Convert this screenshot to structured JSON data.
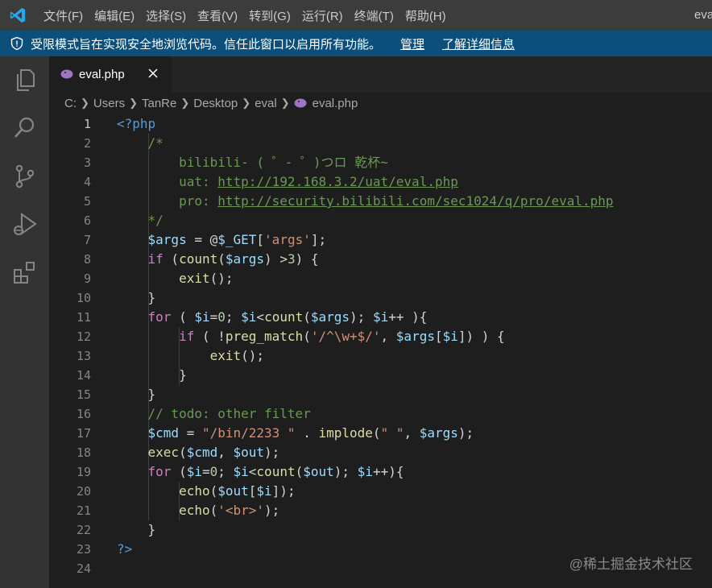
{
  "titlebar": {
    "menu": [
      "文件(F)",
      "编辑(E)",
      "选择(S)",
      "查看(V)",
      "转到(G)",
      "运行(R)",
      "终端(T)",
      "帮助(H)"
    ],
    "window_title": "eval.php"
  },
  "banner": {
    "message": "受限模式旨在实现安全地浏览代码。信任此窗口以启用所有功能。",
    "manage": "管理",
    "learn_more": "了解详细信息"
  },
  "activity_bar": [
    "explorer-icon",
    "search-icon",
    "source-control-icon",
    "run-debug-icon",
    "extensions-icon"
  ],
  "tab": {
    "label": "eval.php",
    "close": "✕"
  },
  "breadcrumb": [
    "C:",
    "Users",
    "TanRe",
    "Desktop",
    "eval",
    "eval.php"
  ],
  "editor": {
    "active_line": 1,
    "line_numbers": [
      "1",
      "2",
      "3",
      "4",
      "5",
      "6",
      "7",
      "8",
      "9",
      "10",
      "11",
      "12",
      "13",
      "14",
      "15",
      "16",
      "17",
      "18",
      "19",
      "20",
      "21",
      "22",
      "23",
      "24"
    ],
    "t": {
      "php_open": "<?php",
      "c_open": "/*",
      "c_bili": "bilibili- ( ゜- ゜)つロ 乾杯~",
      "c_uat": "uat: ",
      "url_uat": "http://192.168.3.2/uat/eval.php",
      "c_pro": "pro: ",
      "url_pro": "http://security.bilibili.com/sec1024/q/pro/eval.php",
      "c_close": "*/",
      "args": "$args",
      "eq_at": " = @",
      "get": "$_GET",
      "lb": "[",
      "s_args": "'args'",
      "rb_semi": "];",
      "if": "if",
      "sp_paren": " (",
      "count": "count",
      "paren": "(",
      "gt3": ") >",
      "three": "3",
      "rparen_brace": ") {",
      "exit": "exit",
      "call_end": "();",
      "brace_close": "}",
      "for": "for",
      "for_open": " ( ",
      "i": "$i",
      "eq": "=",
      "zero": "0",
      "semi_sp": "; ",
      "lt": "<",
      "inc_close": "++ ){",
      "if_open": " ( !",
      "preg": "preg_match",
      "s_regex": "'/^\\w+$/'",
      "comma_sp": ", ",
      "rb_close": "]) ) {",
      "todo": "// todo: other filter",
      "cmd": "$cmd",
      "eq_sp": " = ",
      "s_bin": "\"/bin/2233 \"",
      "dot_sp": " . ",
      "implode": "implode",
      "s_space": "\" \"",
      "rparen_semi": ");",
      "exec": "exec",
      "out": "$out",
      "for_open2": " (",
      "inc_close2": "++){",
      "echo": "echo",
      "rb_rp_semi": "]);",
      "s_br": "'<br>'",
      "php_close": "?>"
    }
  },
  "watermark": "@稀土掘金技术社区"
}
